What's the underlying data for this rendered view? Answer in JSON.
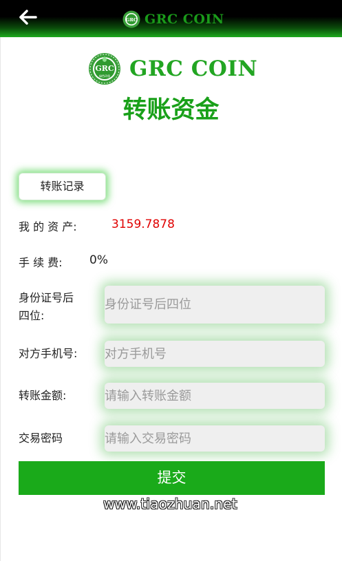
{
  "header": {
    "back_icon": "arrow-left-icon",
    "title": "GRC COIN",
    "logo_text": "GRC"
  },
  "brand": {
    "name": "GRC COIN",
    "logo_text": "GRC",
    "logo_subtext": "绿色环保"
  },
  "page_title": "转账资金",
  "record_button": "转账记录",
  "assets": {
    "label": "我 的 资 产:",
    "value": "3159.7878"
  },
  "fee": {
    "label": "手 续 费:",
    "value": "0%"
  },
  "form": {
    "id_label_line1": "身份证号后",
    "id_label_line2": "四位:",
    "id_placeholder": "身份证号后四位",
    "phone_label": "对方手机号:",
    "phone_placeholder": "对方手机号",
    "amount_label": "转账金额:",
    "amount_placeholder": "请输入转账金额",
    "password_label": "交易密码",
    "password_placeholder": "请输入交易密码"
  },
  "submit_label": "提交",
  "watermark": "www.tiaozhuan.net",
  "colors": {
    "brand_green": "#1aaa1a",
    "asset_red": "#e00000"
  }
}
